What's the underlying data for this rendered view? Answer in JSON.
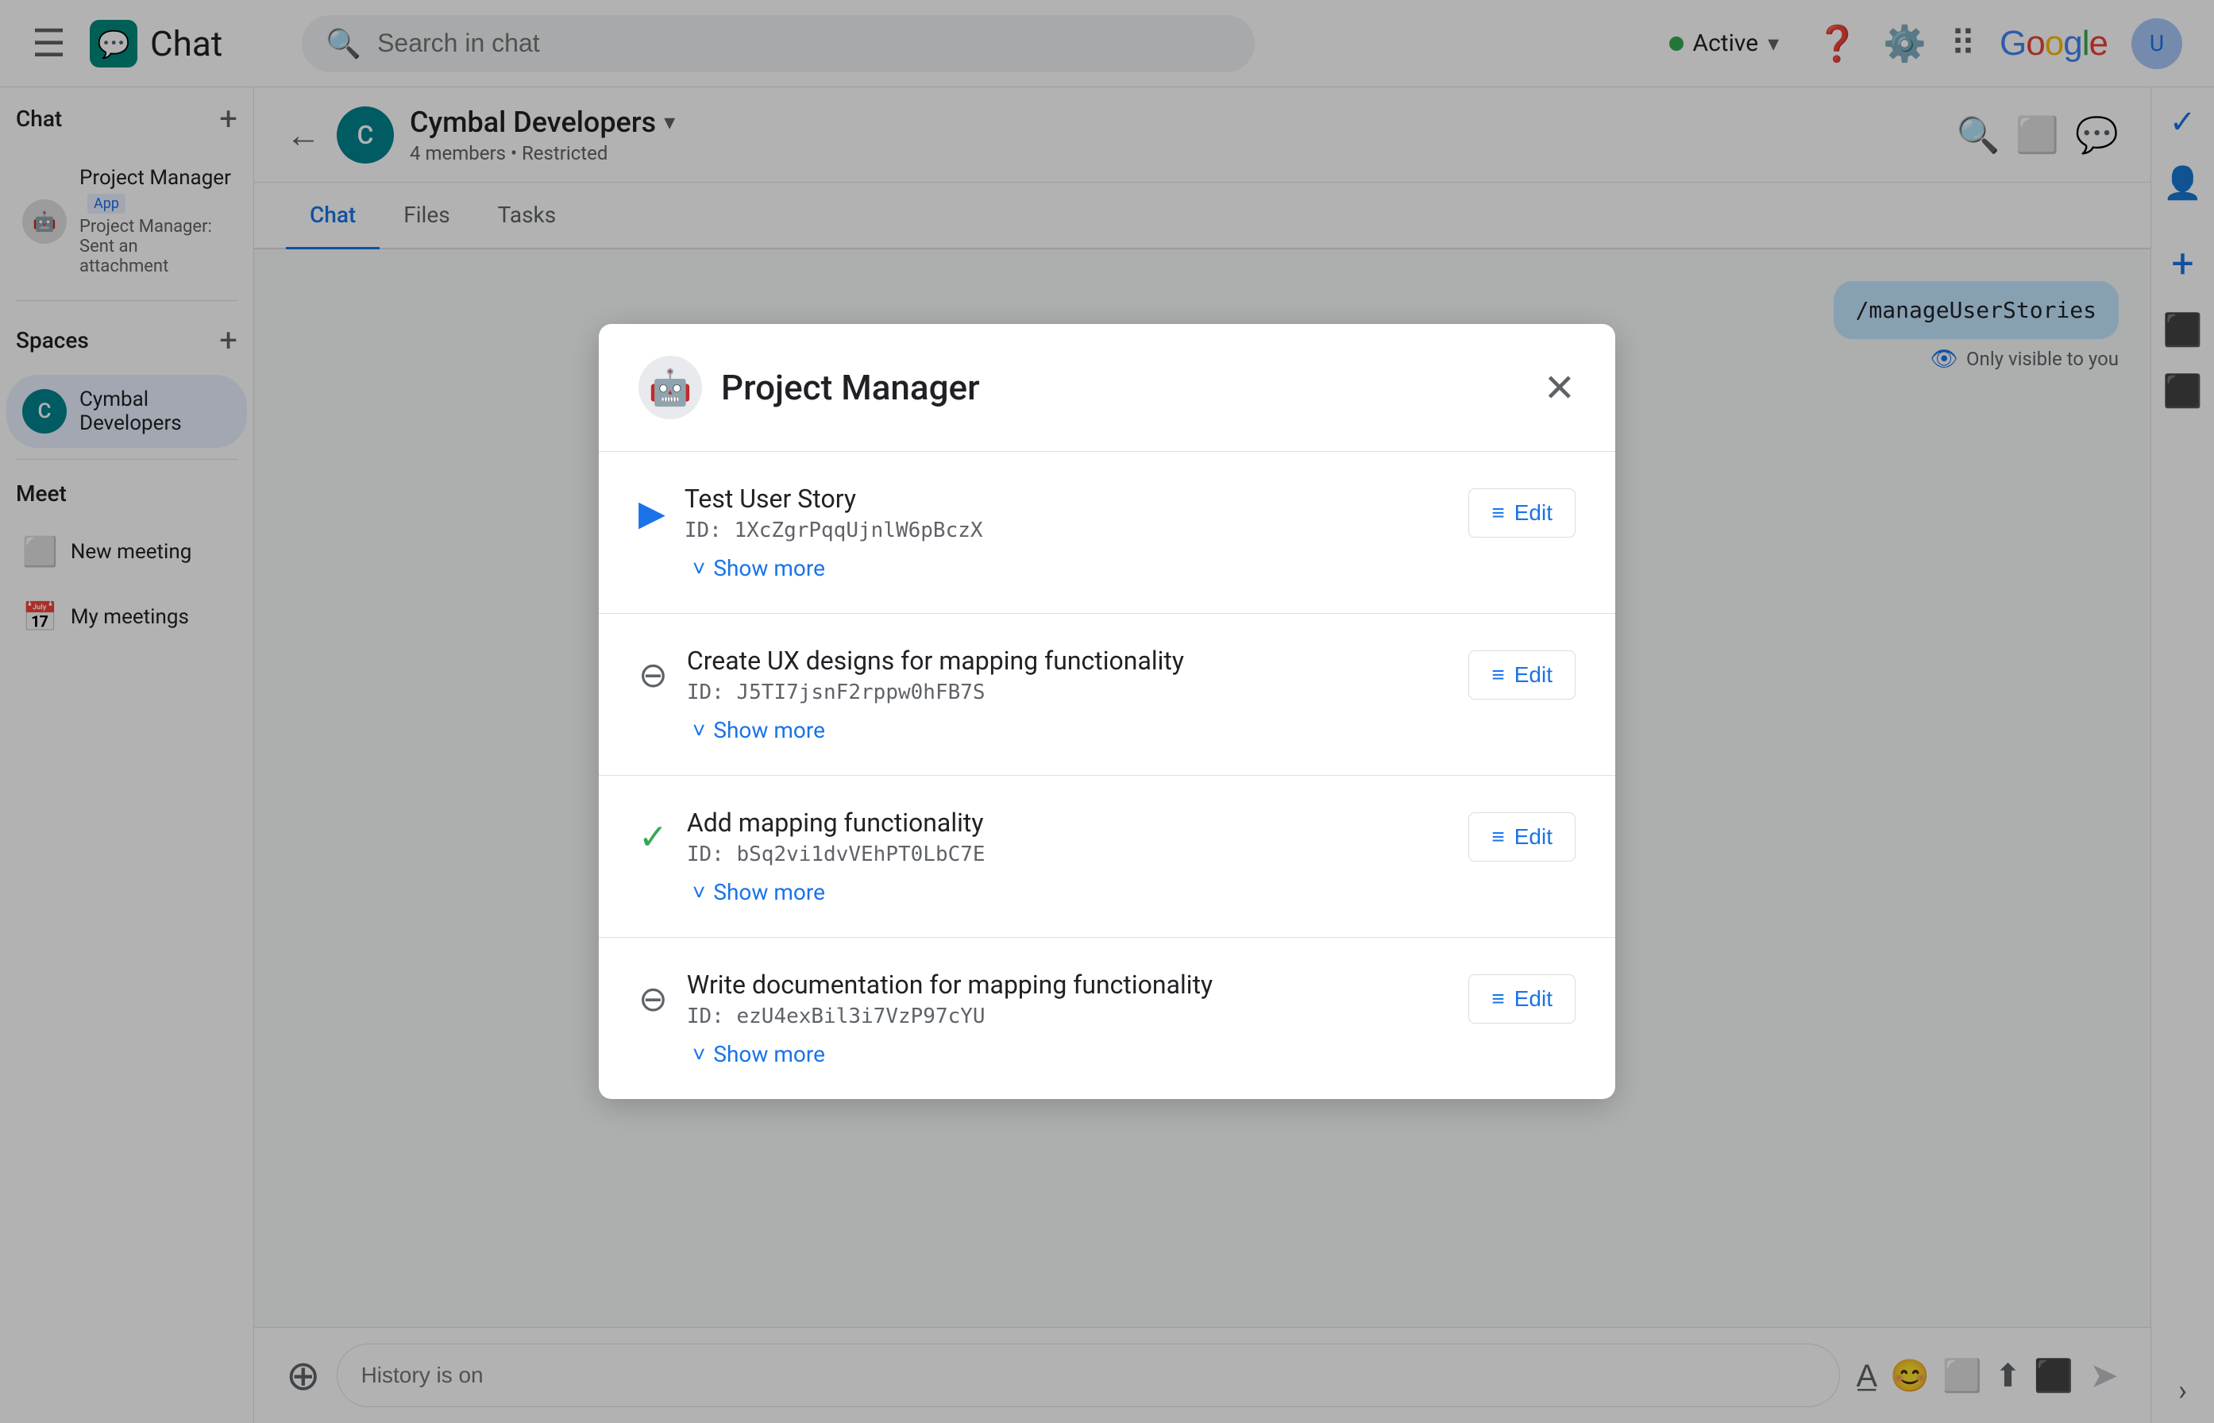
{
  "topbar": {
    "search_placeholder": "Search in chat",
    "status": "Active",
    "app_name": "Chat"
  },
  "sidebar": {
    "chat_section": "Chat",
    "spaces_section": "Spaces",
    "meet_section": "Meet",
    "chat_items": [
      {
        "name": "Project Manager",
        "badge": "App",
        "sub": "Project Manager: Sent an attachment"
      }
    ],
    "spaces_items": [
      {
        "letter": "C",
        "name": "Cymbal Developers"
      }
    ],
    "meet_items": [
      {
        "label": "New meeting"
      },
      {
        "label": "My meetings"
      }
    ]
  },
  "chat_header": {
    "title": "Cymbal Developers",
    "members": "4 members",
    "restricted": "Restricted"
  },
  "tabs": [
    {
      "label": "Chat",
      "active": true
    },
    {
      "label": "Files",
      "active": false
    },
    {
      "label": "Tasks",
      "active": false
    }
  ],
  "messages": [
    {
      "command": "/manageUserStories",
      "only_visible": "Only visible to you"
    }
  ],
  "input": {
    "placeholder": "History is on"
  },
  "modal": {
    "title": "Project Manager",
    "close_label": "×",
    "tasks": [
      {
        "title": "Test User Story",
        "id": "ID: 1XcZgrPqqUjnlW6pBczX",
        "status": "in-progress",
        "edit_label": "Edit",
        "show_more": "Show more"
      },
      {
        "title": "Create UX designs for mapping functionality",
        "id": "ID: J5TI7jsnF2rppw0hFB7S",
        "status": "todo",
        "edit_label": "Edit",
        "show_more": "Show more"
      },
      {
        "title": "Add mapping functionality",
        "id": "ID: bSq2vi1dvVEhPT0LbC7E",
        "status": "done",
        "edit_label": "Edit",
        "show_more": "Show more"
      },
      {
        "title": "Write documentation for mapping functionality",
        "id": "ID: ezU4exBil3i7VzP97cYU",
        "status": "todo",
        "edit_label": "Edit",
        "show_more": "Show more"
      }
    ]
  }
}
